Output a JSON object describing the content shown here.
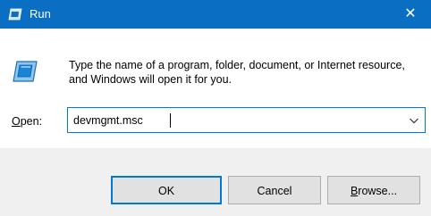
{
  "window": {
    "title": "Run"
  },
  "titlebar": {
    "close_glyph": "✕"
  },
  "icons": {
    "title_icon": "run-icon",
    "program_icon": "run-program-icon",
    "close_icon": "close-icon",
    "dropdown_icon": "chevron-down-icon"
  },
  "description": "Type the name of a program, folder, document, or Internet resource, and Windows will open it for you.",
  "open": {
    "label_access_key": "O",
    "label_rest": "pen:",
    "value": "devmgmt.msc"
  },
  "buttons": {
    "ok": "OK",
    "cancel": "Cancel",
    "browse_access_key": "B",
    "browse_rest": "rowse..."
  },
  "colors": {
    "titlebar": "#0a6fc2",
    "accent": "#0078d7",
    "footer": "#f0f0f0",
    "button": "#e1e1e1"
  }
}
